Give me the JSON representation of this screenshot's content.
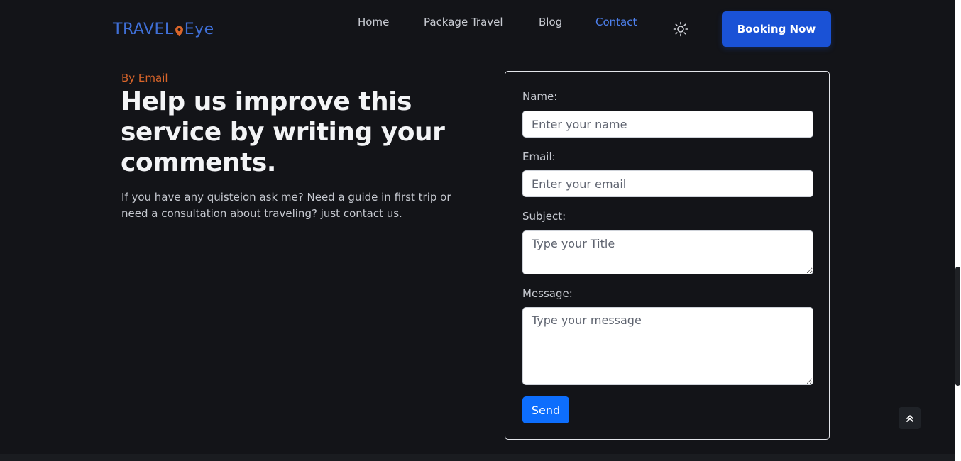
{
  "header": {
    "logo_left": "TRAVEL",
    "logo_right": "Eye",
    "nav": [
      {
        "label": "Home",
        "active": false
      },
      {
        "label": "Package Travel",
        "active": false
      },
      {
        "label": "Blog",
        "active": false
      },
      {
        "label": "Contact",
        "active": true
      }
    ],
    "theme_icon": "sun-icon",
    "booking_label": "Booking Now"
  },
  "contact": {
    "eyebrow": "By Email",
    "heading": "Help us improve this service by writing your comments.",
    "lead": "If you have any quisteion ask me? Need a guide in first trip or need a consultation about traveling? just contact us."
  },
  "form": {
    "name_label": "Name:",
    "name_placeholder": "Enter your name",
    "name_value": "",
    "email_label": "Email:",
    "email_placeholder": "Enter your email",
    "email_value": "",
    "subject_label": "Subject:",
    "subject_placeholder": "Type your Title",
    "subject_value": "",
    "message_label": "Message:",
    "message_placeholder": "Type your message",
    "message_value": "",
    "send_label": "Send"
  },
  "scroll_top_icon": "double-chevron-up-icon",
  "colors": {
    "background": "#131418",
    "accent": "#1a52d6",
    "logo": "#3f6fd6",
    "logo_pin": "#d9652a",
    "eyebrow": "#d9652a",
    "active_nav": "#4e82f0",
    "send_button": "#0d6efd"
  }
}
